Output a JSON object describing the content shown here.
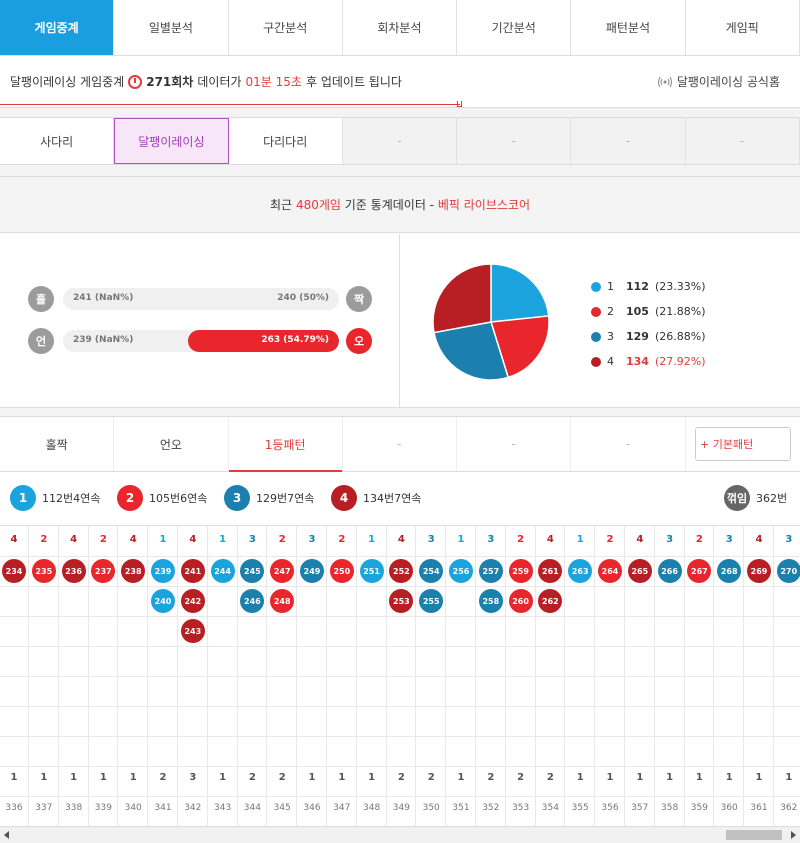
{
  "nav": {
    "tabs": [
      "게임중계",
      "일별분석",
      "구간분석",
      "회차분석",
      "기간분석",
      "패턴분석",
      "게임픽"
    ],
    "active": 0
  },
  "info": {
    "prefix": "달팽이레이싱 게임중계",
    "round": "271회차",
    "mid": "데이터가",
    "time": "01분 15초",
    "suffix": "후 업데이트 됩니다",
    "official": "달팽이레이싱 공식홈"
  },
  "games": {
    "tabs": [
      "사다리",
      "달팽이레이싱",
      "다리다리",
      "-",
      "-",
      "-",
      "-"
    ],
    "active": 1
  },
  "stats": {
    "head_prefix": "최근",
    "head_count": "480게임",
    "head_mid": "기준 통계데이터 -",
    "head_brand": "베픽 라이브스코어",
    "row1": {
      "left_label": "홀",
      "left_value": "241 (NaN%)",
      "right_value": "240 (50%)",
      "right_label": "짝",
      "right_fraction": 0
    },
    "row2": {
      "left_label": "언",
      "left_value": "239 (NaN%)",
      "right_value": "263 (54.79%)",
      "right_label": "오",
      "right_fraction": 0.5479
    },
    "pie": [
      {
        "label": "1",
        "value": 112,
        "text": "112",
        "pct": "(23.33%)",
        "color": "#1aa3dd"
      },
      {
        "label": "2",
        "value": 105,
        "text": "105",
        "pct": "(21.88%)",
        "color": "#e8262c"
      },
      {
        "label": "3",
        "value": 129,
        "text": "129",
        "pct": "(26.88%)",
        "color": "#1b80ad"
      },
      {
        "label": "4",
        "value": 134,
        "text": "134",
        "pct": "(27.92%)",
        "color": "#b81f25"
      }
    ]
  },
  "patterns": {
    "tabs": [
      "홀짝",
      "언오",
      "1등패턴",
      "-",
      "-",
      "-"
    ],
    "active": 2,
    "basic_button": "+ 기본패턴"
  },
  "summary": {
    "items": [
      {
        "num": "1",
        "text": "112번4연속",
        "color": "#1aa3dd"
      },
      {
        "num": "2",
        "text": "105번6연속",
        "color": "#e8262c"
      },
      {
        "num": "3",
        "text": "129번7연속",
        "color": "#1b80ad"
      },
      {
        "num": "4",
        "text": "134번7연속",
        "color": "#b81f25"
      }
    ],
    "break_label": "꺾임",
    "break_count": "362번"
  },
  "grid": {
    "columns": [
      {
        "head": "4",
        "balls": [
          "234"
        ],
        "count": "1",
        "round": "336"
      },
      {
        "head": "2",
        "balls": [
          "235"
        ],
        "count": "1",
        "round": "337"
      },
      {
        "head": "4",
        "balls": [
          "236"
        ],
        "count": "1",
        "round": "338"
      },
      {
        "head": "2",
        "balls": [
          "237"
        ],
        "count": "1",
        "round": "339"
      },
      {
        "head": "4",
        "balls": [
          "238"
        ],
        "count": "1",
        "round": "340"
      },
      {
        "head": "1",
        "balls": [
          "239",
          "240"
        ],
        "count": "2",
        "round": "341"
      },
      {
        "head": "4",
        "balls": [
          "241",
          "242",
          "243"
        ],
        "count": "3",
        "round": "342"
      },
      {
        "head": "1",
        "balls": [
          "244"
        ],
        "count": "1",
        "round": "343"
      },
      {
        "head": "3",
        "balls": [
          "245",
          "246"
        ],
        "count": "2",
        "round": "344"
      },
      {
        "head": "2",
        "balls": [
          "247",
          "248"
        ],
        "count": "2",
        "round": "345"
      },
      {
        "head": "3",
        "balls": [
          "249"
        ],
        "count": "1",
        "round": "346"
      },
      {
        "head": "2",
        "balls": [
          "250"
        ],
        "count": "1",
        "round": "347"
      },
      {
        "head": "1",
        "balls": [
          "251"
        ],
        "count": "1",
        "round": "348"
      },
      {
        "head": "4",
        "balls": [
          "252",
          "253"
        ],
        "count": "2",
        "round": "349"
      },
      {
        "head": "3",
        "balls": [
          "254",
          "255"
        ],
        "count": "2",
        "round": "350"
      },
      {
        "head": "1",
        "balls": [
          "256"
        ],
        "count": "1",
        "round": "351"
      },
      {
        "head": "3",
        "balls": [
          "257",
          "258"
        ],
        "count": "2",
        "round": "352"
      },
      {
        "head": "2",
        "balls": [
          "259",
          "260"
        ],
        "count": "2",
        "round": "353"
      },
      {
        "head": "4",
        "balls": [
          "261",
          "262"
        ],
        "count": "2",
        "round": "354"
      },
      {
        "head": "1",
        "balls": [
          "263"
        ],
        "count": "1",
        "round": "355"
      },
      {
        "head": "2",
        "balls": [
          "264"
        ],
        "count": "1",
        "round": "356"
      },
      {
        "head": "4",
        "balls": [
          "265"
        ],
        "count": "1",
        "round": "357"
      },
      {
        "head": "3",
        "balls": [
          "266"
        ],
        "count": "1",
        "round": "358"
      },
      {
        "head": "2",
        "balls": [
          "267"
        ],
        "count": "1",
        "round": "359"
      },
      {
        "head": "3",
        "balls": [
          "268"
        ],
        "count": "1",
        "round": "360"
      },
      {
        "head": "4",
        "balls": [
          "269"
        ],
        "count": "1",
        "round": "361"
      },
      {
        "head": "3",
        "balls": [
          "270"
        ],
        "count": "1",
        "round": "362"
      }
    ]
  },
  "colors": {
    "1": "#1aa3dd",
    "2": "#e8262c",
    "3": "#1b80ad",
    "4": "#b81f25"
  }
}
